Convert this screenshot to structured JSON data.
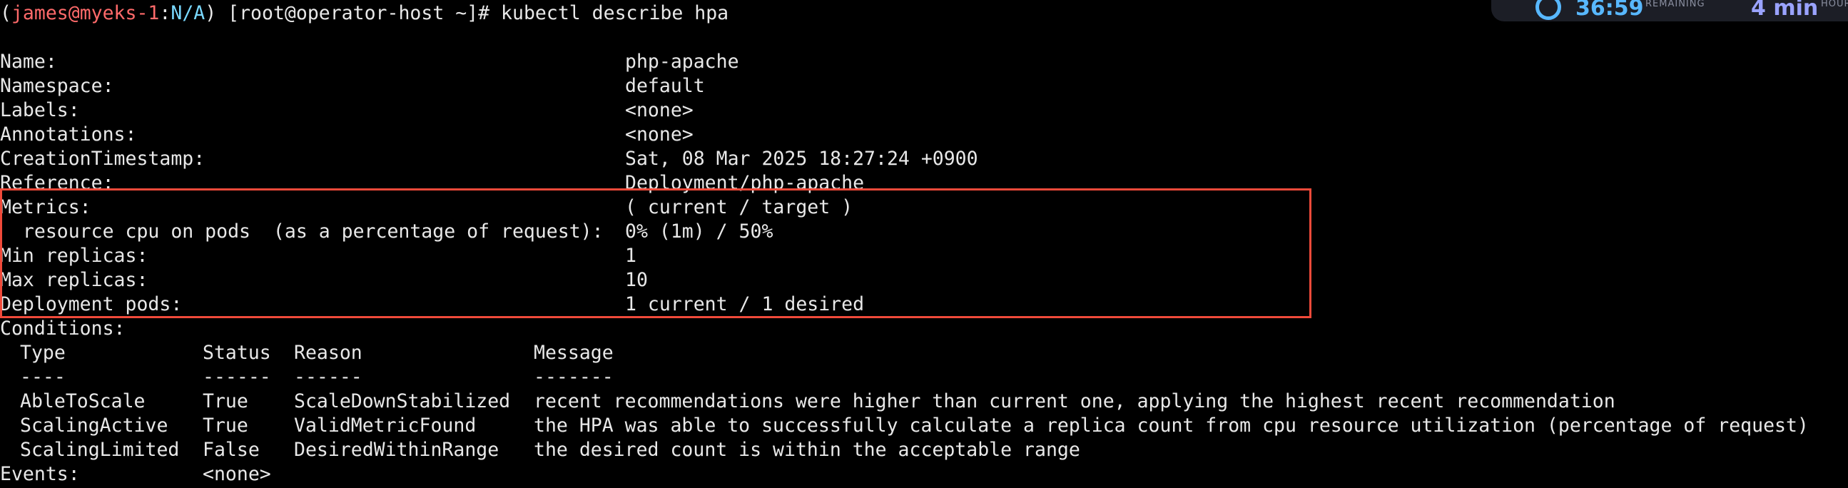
{
  "prompt": {
    "open_paren": "(",
    "user": "james@myeks-1",
    "colon": ":",
    "context": "N/A",
    "rest": ") [root@operator-host ~]# kubectl describe hpa"
  },
  "overlay": {
    "timer": "36:59",
    "timer_label": "REMAINING",
    "minutes": "4 min",
    "minutes_label": "HOURS"
  },
  "hpa": {
    "name_label": "Name:",
    "name_value": "php-apache",
    "namespace_label": "Namespace:",
    "namespace_value": "default",
    "labels_label": "Labels:",
    "labels_value": "<none>",
    "annotations_label": "Annotations:",
    "annotations_value": "<none>",
    "creation_label": "CreationTimestamp:",
    "creation_value": "Sat, 08 Mar 2025 18:27:24 +0900",
    "reference_label": "Reference:",
    "reference_value": "Deployment/php-apache",
    "metrics_label": "Metrics:",
    "metrics_value": "( current / target )",
    "resource_label": "  resource cpu on pods  (as a percentage of request):",
    "resource_value": "0% (1m) / 50%",
    "min_label": "Min replicas:",
    "min_value": "1",
    "max_label": "Max replicas:",
    "max_value": "10",
    "deploy_label": "Deployment pods:",
    "deploy_value": "1 current / 1 desired",
    "conditions_label": "Conditions:",
    "events_label": "Events:",
    "events_value": "<none>"
  },
  "conditions": {
    "header": {
      "type": "Type",
      "status": "Status",
      "reason": "Reason",
      "message": "Message"
    },
    "divider": {
      "type": "----",
      "status": "------",
      "reason": "------",
      "message": "-------"
    },
    "rows": [
      {
        "type": "AbleToScale",
        "status": "True",
        "reason": "ScaleDownStabilized",
        "message": "recent recommendations were higher than current one, applying the highest recent recommendation"
      },
      {
        "type": "ScalingActive",
        "status": "True",
        "reason": "ValidMetricFound",
        "message": "the HPA was able to successfully calculate a replica count from cpu resource utilization (percentage of request)"
      },
      {
        "type": "ScalingLimited",
        "status": "False",
        "reason": "DesiredWithinRange",
        "message": "the desired count is within the acceptable range"
      }
    ]
  },
  "colors": {
    "background": "#000000",
    "text": "#e8e8e8",
    "prompt_user": "#ff6a6a",
    "prompt_context": "#7ad9ff",
    "highlight": "#f04a3a"
  }
}
